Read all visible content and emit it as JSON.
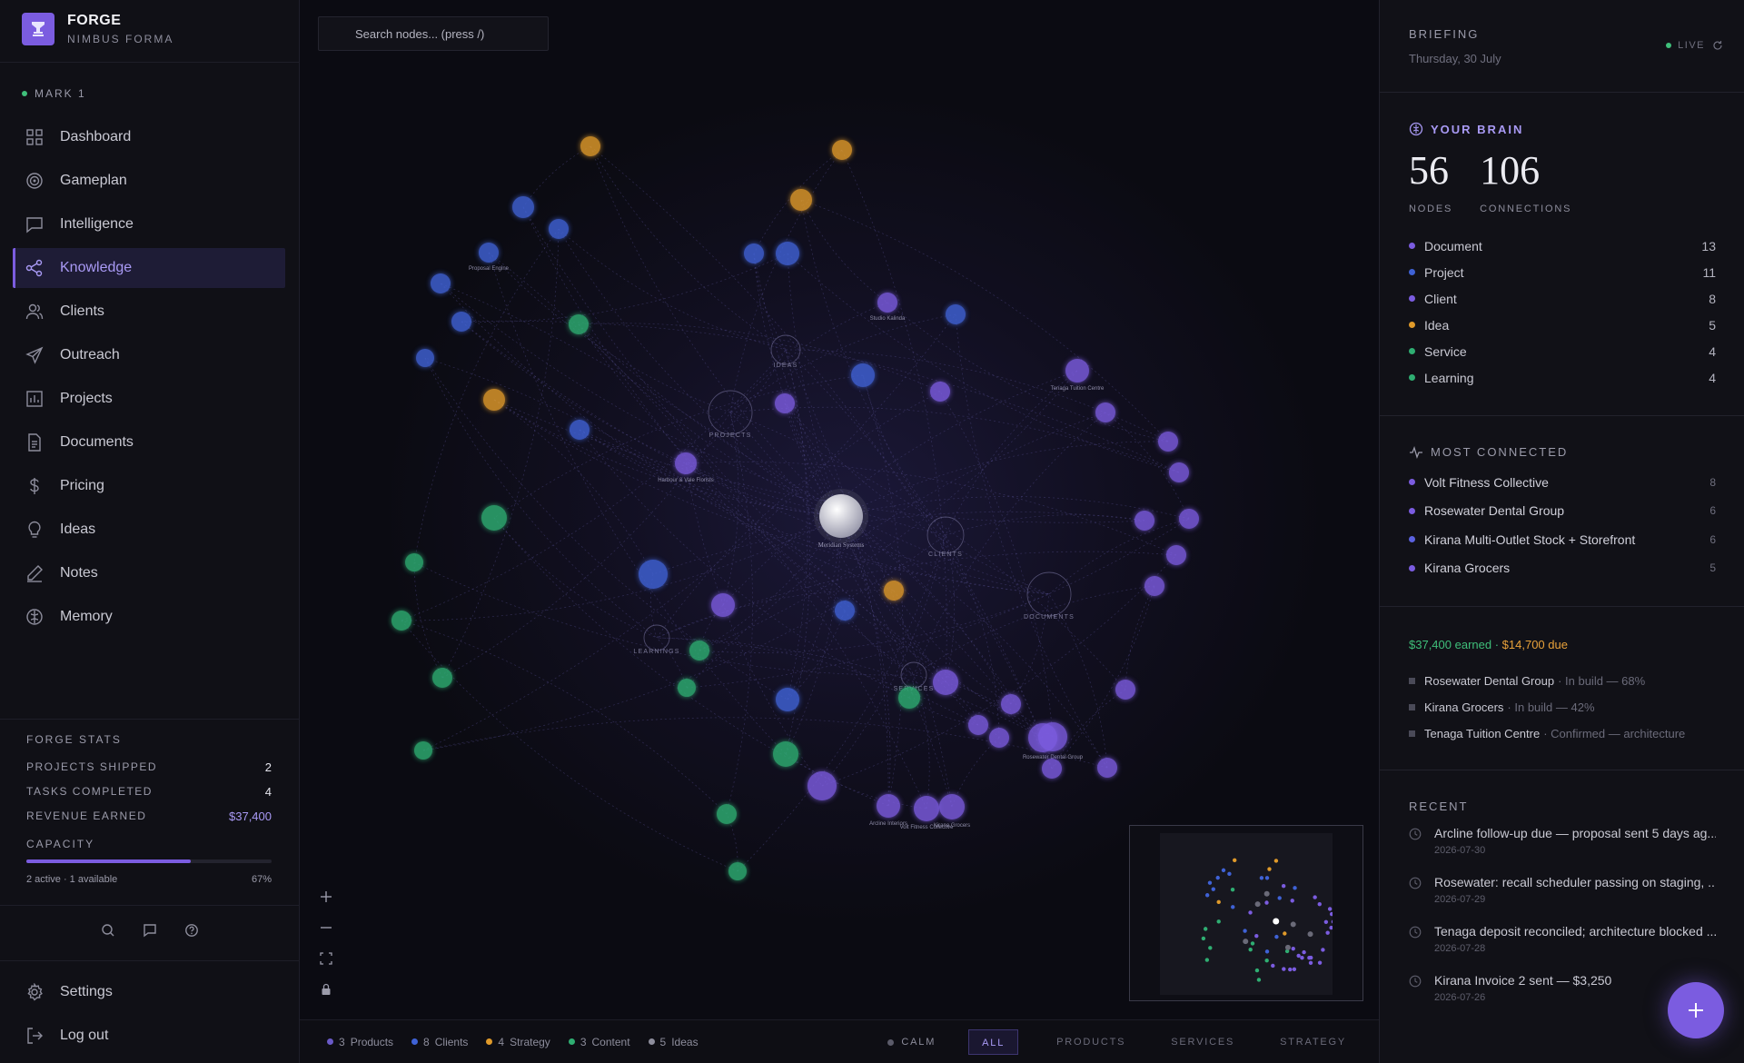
{
  "brand": {
    "name": "FORGE",
    "subtitle": "NIMBUS FORMA"
  },
  "operator": {
    "label": "MARK 1"
  },
  "nav": [
    {
      "label": "Dashboard",
      "icon": "grid-icon"
    },
    {
      "label": "Gameplan",
      "icon": "target-icon"
    },
    {
      "label": "Intelligence",
      "icon": "chat-icon"
    },
    {
      "label": "Knowledge",
      "icon": "share-nodes-icon",
      "active": true
    },
    {
      "label": "Clients",
      "icon": "users-icon"
    },
    {
      "label": "Outreach",
      "icon": "send-icon"
    },
    {
      "label": "Projects",
      "icon": "chart-icon"
    },
    {
      "label": "Documents",
      "icon": "document-icon"
    },
    {
      "label": "Pricing",
      "icon": "dollar-icon"
    },
    {
      "label": "Ideas",
      "icon": "bulb-icon"
    },
    {
      "label": "Notes",
      "icon": "pen-icon"
    },
    {
      "label": "Memory",
      "icon": "brain-icon"
    }
  ],
  "stats": {
    "title": "FORGE STATS",
    "rows": [
      {
        "label": "PROJECTS SHIPPED",
        "value": "2"
      },
      {
        "label": "TASKS COMPLETED",
        "value": "4"
      },
      {
        "label": "REVENUE EARNED",
        "value": "$37,400"
      }
    ],
    "capacity": {
      "label": "CAPACITY",
      "detail": "2 active · 1 available",
      "percent_label": "67%",
      "percent": 67
    }
  },
  "bottom_nav": [
    {
      "label": "Settings",
      "icon": "gear-icon"
    },
    {
      "label": "Log out",
      "icon": "logout-icon"
    }
  ],
  "search": {
    "placeholder": "Search nodes... (press /)"
  },
  "colors": {
    "document": "#7b5ce0",
    "project": "#3f62d6",
    "client": "#7b5ce0",
    "idea": "#e09a2a",
    "service": "#2fae72",
    "learning": "#2fae72",
    "accent": "#7b5ce0"
  },
  "graph": {
    "center": {
      "label": "Meridian Systems"
    },
    "clusters": [
      "IDEAS",
      "PROJECTS",
      "CLIENTS",
      "DOCUMENTS",
      "LEARNINGS",
      "SERVICES"
    ],
    "node_labels": [
      "Proposal Engine",
      "Studio Kalinda",
      "Tenaga Tuition Centre",
      "Harbour & Vale Florists",
      "Rosewater Dental Group",
      "Volt Fitness Collective",
      "Arcline Interiors",
      "Kirana Grocers"
    ]
  },
  "legend": [
    {
      "count": "3",
      "label": "Products",
      "color": "#6a5ac8"
    },
    {
      "count": "8",
      "label": "Clients",
      "color": "#3f62d6"
    },
    {
      "count": "4",
      "label": "Strategy",
      "color": "#e09a2a"
    },
    {
      "count": "3",
      "label": "Content",
      "color": "#2fae72"
    },
    {
      "count": "5",
      "label": "Ideas",
      "color": "#8d8d9c"
    }
  ],
  "mode": {
    "label": "CALM"
  },
  "filters": [
    {
      "label": "ALL",
      "active": true
    },
    {
      "label": "PRODUCTS"
    },
    {
      "label": "SERVICES"
    },
    {
      "label": "STRATEGY"
    }
  ],
  "briefing": {
    "title": "BRIEFING",
    "date": "Thursday, 30 July",
    "live": "LIVE"
  },
  "brain": {
    "title": "YOUR BRAIN",
    "nodes": "56",
    "nodes_label": "NODES",
    "connections": "106",
    "connections_label": "CONNECTIONS",
    "types": [
      {
        "label": "Document",
        "count": "13",
        "color": "#7b5ce0"
      },
      {
        "label": "Project",
        "count": "11",
        "color": "#3f62d6"
      },
      {
        "label": "Client",
        "count": "8",
        "color": "#7b5ce0"
      },
      {
        "label": "Idea",
        "count": "5",
        "color": "#e09a2a"
      },
      {
        "label": "Service",
        "count": "4",
        "color": "#2fae72"
      },
      {
        "label": "Learning",
        "count": "4",
        "color": "#2fae72"
      }
    ]
  },
  "most_connected": {
    "title": "MOST CONNECTED",
    "items": [
      {
        "label": "Volt Fitness Collective",
        "count": "8"
      },
      {
        "label": "Rosewater Dental Group",
        "count": "6"
      },
      {
        "label": "Kirana Multi-Outlet Stock + Storefront",
        "count": "6"
      },
      {
        "label": "Kirana Grocers",
        "count": "5"
      }
    ]
  },
  "finance": {
    "earned": "$37,400 earned",
    "separator": " · ",
    "due": "$14,700 due",
    "projects": [
      {
        "name": "Rosewater Dental Group",
        "status": "· In build — 68%"
      },
      {
        "name": "Kirana Grocers",
        "status": "· In build — 42%"
      },
      {
        "name": "Tenaga Tuition Centre",
        "status": "· Confirmed — architecture"
      }
    ]
  },
  "recent": {
    "title": "RECENT",
    "items": [
      {
        "title": "Arcline follow-up due — proposal sent 5 days ag...",
        "date": "2026-07-30"
      },
      {
        "title": "Rosewater: recall scheduler passing on staging, ...",
        "date": "2026-07-29"
      },
      {
        "title": "Tenaga deposit reconciled; architecture blocked ...",
        "date": "2026-07-28"
      },
      {
        "title": "Kirana Invoice 2 sent — $3,250",
        "date": "2026-07-26"
      }
    ]
  }
}
